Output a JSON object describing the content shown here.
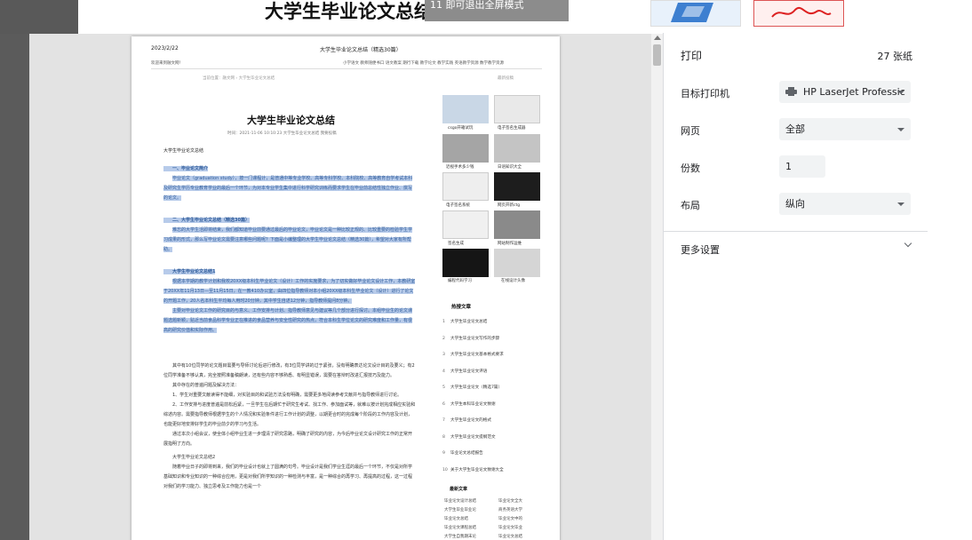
{
  "background_page": {
    "title": "大学生毕业论文总结",
    "overlay_message": "11 即可退出全屏模式",
    "thumb1_caption": "csgo开箱试玩",
    "thumb2_caption": "电子签名生成器"
  },
  "preview": {
    "header_date": "2023/2/22",
    "header_title": "大学生毕业论文总结（精选30篇）",
    "nav_left": "欢迎来到融文网！",
    "nav_right": "小学语文  教师随便书口  语文教案  期行下载  教学论文  教学实践  英语教学资源  数学教学资源",
    "breadcrumb": "当前位置：融文网 › 大学生毕业论文总结",
    "breadcrumb_right": "最新投稿",
    "article_title": "大学生毕业论文总结",
    "article_meta": "时间：2021-11-06 10:10:23    大学生毕业论文总结    我要投稿",
    "article_lead": "大学生毕业论文总结",
    "sec1_head": "一、毕业论文简介",
    "sec1_body": "毕业论文（graduation study），按一门课程计，是普通中等专业学校、高等专科学校、本科院校、高等教育自学考试本科及研究生学历专业教育学业的最后一个环节，为对本专业学生集中进行科学研究训练而要求学生在毕业前总结性独立作业、撰写的论文。",
    "sec2_head": "二、大学生毕业论文总结（精选30篇）",
    "sec2_body": "难忘的大学生活即将结束，我们都知道毕业前要通过最后的毕业论文，毕业论文是一种比较正规的、比较重要的检验学生学习成果的形式，那么写毕业论文需要注意哪些问题呢？下面是小编整理的大学生毕业论文总结（精选30篇），希望对大家有所帮助。",
    "sec3_head": "大学生毕业论文总结1",
    "sec3_body": "根据本学期的教学计划和我校20XX级本科生毕业论文（设计）工作的实施要求，为了切实做好毕业论文设计工作，本教研室于20XX年11月13日—至11月15日，在一教410办公室，由四位指导教师对本小组20XX级本科生毕业论文（设计）进行了论文的开题工作，20人名本科生平均每人用时20分钟，其中学生自述12分钟，指导教师提问8分钟。",
    "sec3_body2": "主要对毕业论文工作的研究目的与意义、工作安排与计划、指导教师意见与建议等几个部分进行探讨。本组毕业生的论文课题选题新颖，贴近当前食品科学专业正在推进的食品营养与安全性研究的热点，符合本科生学位论文的研究难度和工作量，有很高的研究价值和实际作用。",
    "para4": "其中有10位同学的论文题目需要与导师讨论后进行修改，有3位同学讲的过于紧张，没有明确表达论文设计目的及要义；有2位同学准备不够认真，完全按照准备稿朗读，还有些内容不够熟悉、有明显错误，需要在答辩时改进汇报技巧及能力。",
    "para5": "其中存在的普遍问题及解决方法：",
    "para6": "1、学生对重要文献读得不能细，对实验目的和试验方法没有明确，需要更多地阅读参考文献并与指导教师进行讨论。",
    "para7": "2、工作安排与进度普遍是前松后紧，一旦学生在后期忙于研究生考试、找工作、参加面试等，就难以按计划完成相应实验和综述内容。需要指导教师根据学生的个人情况和实验条件进行工作计划的调整，以期更合时的完成每个阶段的工作内容及计划，也能更好地安排好学生的毕业前夕的学习与生活。",
    "para8": "通过本次小组会议，使全体小组毕业生进一步理清了研究思路，明确了研究的内容，为今后毕业论文设计研究工作的正常开展指明了方向。",
    "sec4_head": "大学生毕业论文总结2",
    "para9": "随着毕业日子的即将到来，我们的毕业设计也就上了圆满的句号。毕业设计是我们学业生涯的最后一个环节，不仅是对所学基础知识和专业知识的一种综合应用，更是对我们所学知识的一种检测与丰富，是一种综合的再学习、再提高的过程，这一过程对我们的学习能力、独立思考及工作能力也是一个",
    "side_captions": [
      "csgo开箱试玩",
      "电子签名生成器",
      "近视手术多少钱",
      "日语知识大全",
      "电子签名系统",
      "网页开新ctg",
      "签名生成",
      "网站制作运维",
      "编程代码学习",
      "在线设计头像"
    ],
    "hot_title": "热搜文章",
    "hot_list": [
      {
        "n": "1",
        "t": "大学生毕业论文总结"
      },
      {
        "n": "2",
        "t": "大学生毕业论文写作的步骤"
      },
      {
        "n": "3",
        "t": "大学生毕业论文基本格式要求"
      },
      {
        "n": "4",
        "t": "大学生毕业论文评语"
      },
      {
        "n": "5",
        "t": "大学生毕业论文（精选7篇）"
      },
      {
        "n": "6",
        "t": "大学生本科毕业论文致谢"
      },
      {
        "n": "7",
        "t": "大学生毕业论文的格式"
      },
      {
        "n": "8",
        "t": "大学生毕业论文提纲范文"
      },
      {
        "n": "9",
        "t": "毕业论文总结报告"
      },
      {
        "n": "10",
        "t": "关于大学生毕业论文致谢大全"
      }
    ],
    "new_title": "最新文章",
    "new_col1": [
      "毕业论文设计总结",
      "大学生毕业毕业论",
      "毕业论文总结",
      "毕业论文课程总结",
      "大学生自我期末论"
    ],
    "new_col2": [
      "毕业论文全大",
      "商务英语大学",
      "毕业论文中的",
      "毕业论文毕业",
      "毕业论文总结"
    ]
  },
  "panel": {
    "title": "打印",
    "page_count": "27 张纸",
    "printer_label": "目标打印机",
    "printer_value": "HP LaserJet Professic",
    "pages_label": "网页",
    "pages_value": "全部",
    "copies_label": "份数",
    "copies_value": "1",
    "layout_label": "布局",
    "layout_value": "纵向",
    "more_settings": "更多设置"
  }
}
